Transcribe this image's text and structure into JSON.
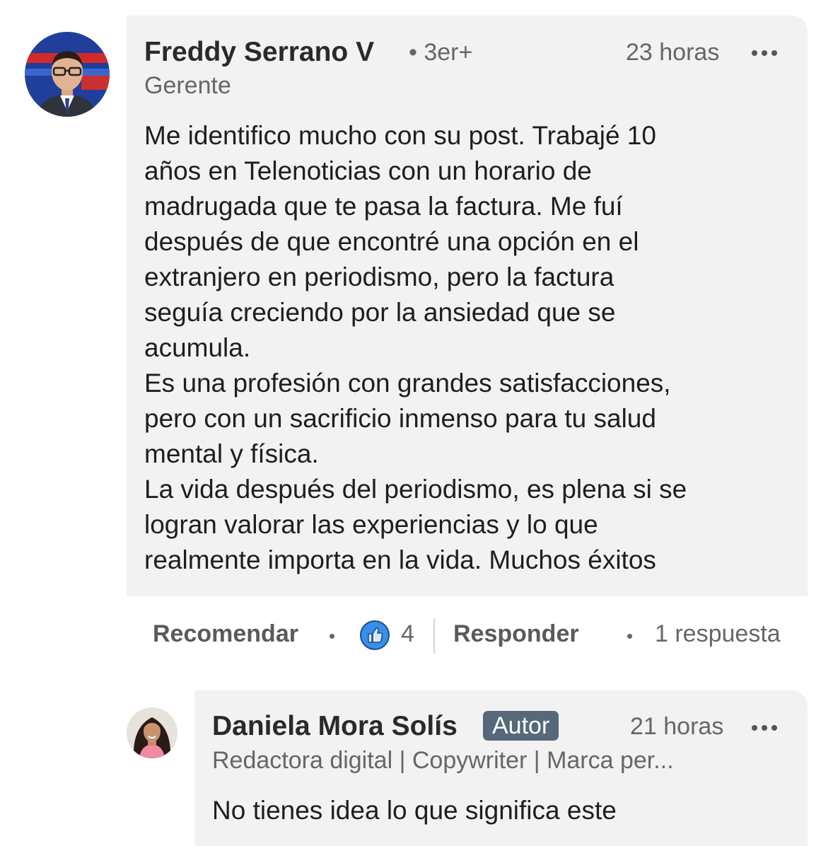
{
  "comment": {
    "author_name": "Freddy Serrano V",
    "connection_degree": "• 3er+",
    "headline": "Gerente",
    "time": "23 horas",
    "more_label": "•••",
    "text": "Me identifico mucho con su post. Trabajé 10\naños en Telenoticias con un horario de\nmadrugada que te pasa la factura. Me fuí\ndespués de que encontré una opción en el\nextranjero en periodismo, pero la factura\nseguía creciendo por la ansiedad que se\nacumula.\nEs una profesión con grandes satisfacciones,\npero con un sacrificio inmenso para tu salud\nmental y física.\nLa vida después del periodismo, es plena si se\nlogran valorar las experiencias y lo que\nrealmente importa en la vida. Muchos éxitos",
    "actions": {
      "recommend_label": "Recomendar",
      "separator": "•",
      "reaction_count": "4",
      "reply_label": "Responder",
      "replies_count_label": "1 respuesta"
    }
  },
  "reply": {
    "author_name": "Daniela Mora Solís",
    "author_badge": "Autor",
    "headline": "Redactora digital | Copywriter | Marca per...",
    "time": "21 horas",
    "text": "No tienes idea lo que significa este"
  },
  "icons": {
    "like_reaction": "thumbs-up-icon",
    "more_options": "ellipsis-icon"
  },
  "colors": {
    "bubble_bg": "#f2f2f2",
    "like_blue": "#378fe9",
    "badge_bg": "#56687a"
  }
}
